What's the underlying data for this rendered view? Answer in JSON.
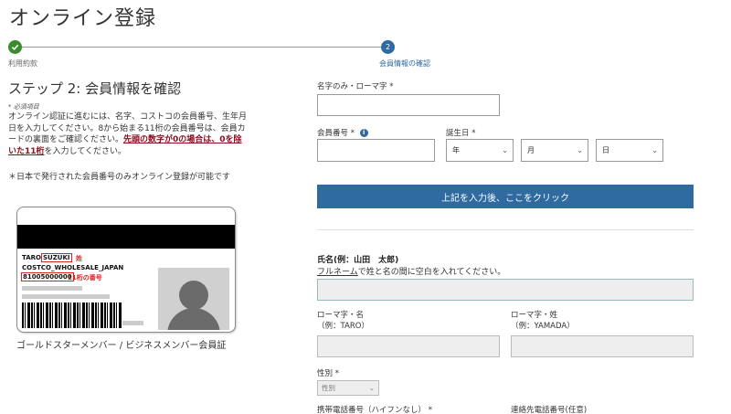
{
  "page": {
    "title": "オンライン登録"
  },
  "progress": {
    "step1": {
      "label": "利用約款",
      "state": "done"
    },
    "step2": {
      "number": "2",
      "label": "会員情報の確認",
      "state": "current"
    }
  },
  "left": {
    "heading": "ステップ 2: 会員情報を確認",
    "required_note": "* 必須項目",
    "instructions_plain": "オンライン認証に進むには、名字、コストコの会員番号、生年月日を入力してください。8から始まる11桁の会員番号は、会員カードの裏面をご確認ください。",
    "instructions_emphasis": "先頭の数字が0の場合は、0を除いた11桁",
    "instructions_tail": "を入力してください。",
    "japan_note": "＊日本で発行された会員番号のみオンライン登録が可能です",
    "card": {
      "name_first": "TARO",
      "name_last": "SUZUKI",
      "surname_tag": "姓",
      "company": "COSTCO_WHOLESALE_JAPAN",
      "number": "81005000000",
      "number_tag": "11桁の番号"
    },
    "card_caption": "ゴールドスターメンバー / ビジネスメンバー会員証"
  },
  "form": {
    "surname_roman_label": "名字のみ・ローマ字",
    "required_mark": "*",
    "member_number_label": "会員番号",
    "info_icon_glyph": "i",
    "birthdate_label": "誕生日",
    "year_placeholder": "年",
    "month_placeholder": "月",
    "day_placeholder": "日",
    "chevron_glyph": "⌄",
    "submit_label": "上記を入力後、ここをクリック",
    "fullname_label": "氏名(例：山田　太郎)",
    "fullname_help_link": "フルネーム",
    "fullname_help_rest": "で姓と名の間に空白を入れてください。",
    "first_roman_label": "ローマ字・名",
    "first_roman_example": "（例：TARO）",
    "last_roman_label": "ローマ字・姓",
    "last_roman_example": "（例：YAMADA）",
    "gender_label": "性別",
    "gender_placeholder": "性別",
    "mobile_label": "携帯電話番号（ハイフンなし）",
    "alt_phone_label": "連絡先電話番号(任意)"
  },
  "colors": {
    "accent": "#2f6aa0",
    "done": "#3a8a2e",
    "emphasis": "#8a1020",
    "card_mark": "#dd2222"
  },
  "icons": {
    "step1": "checkmark-icon",
    "member_number_info": "info-icon",
    "select_chevron": "chevron-down-icon"
  }
}
